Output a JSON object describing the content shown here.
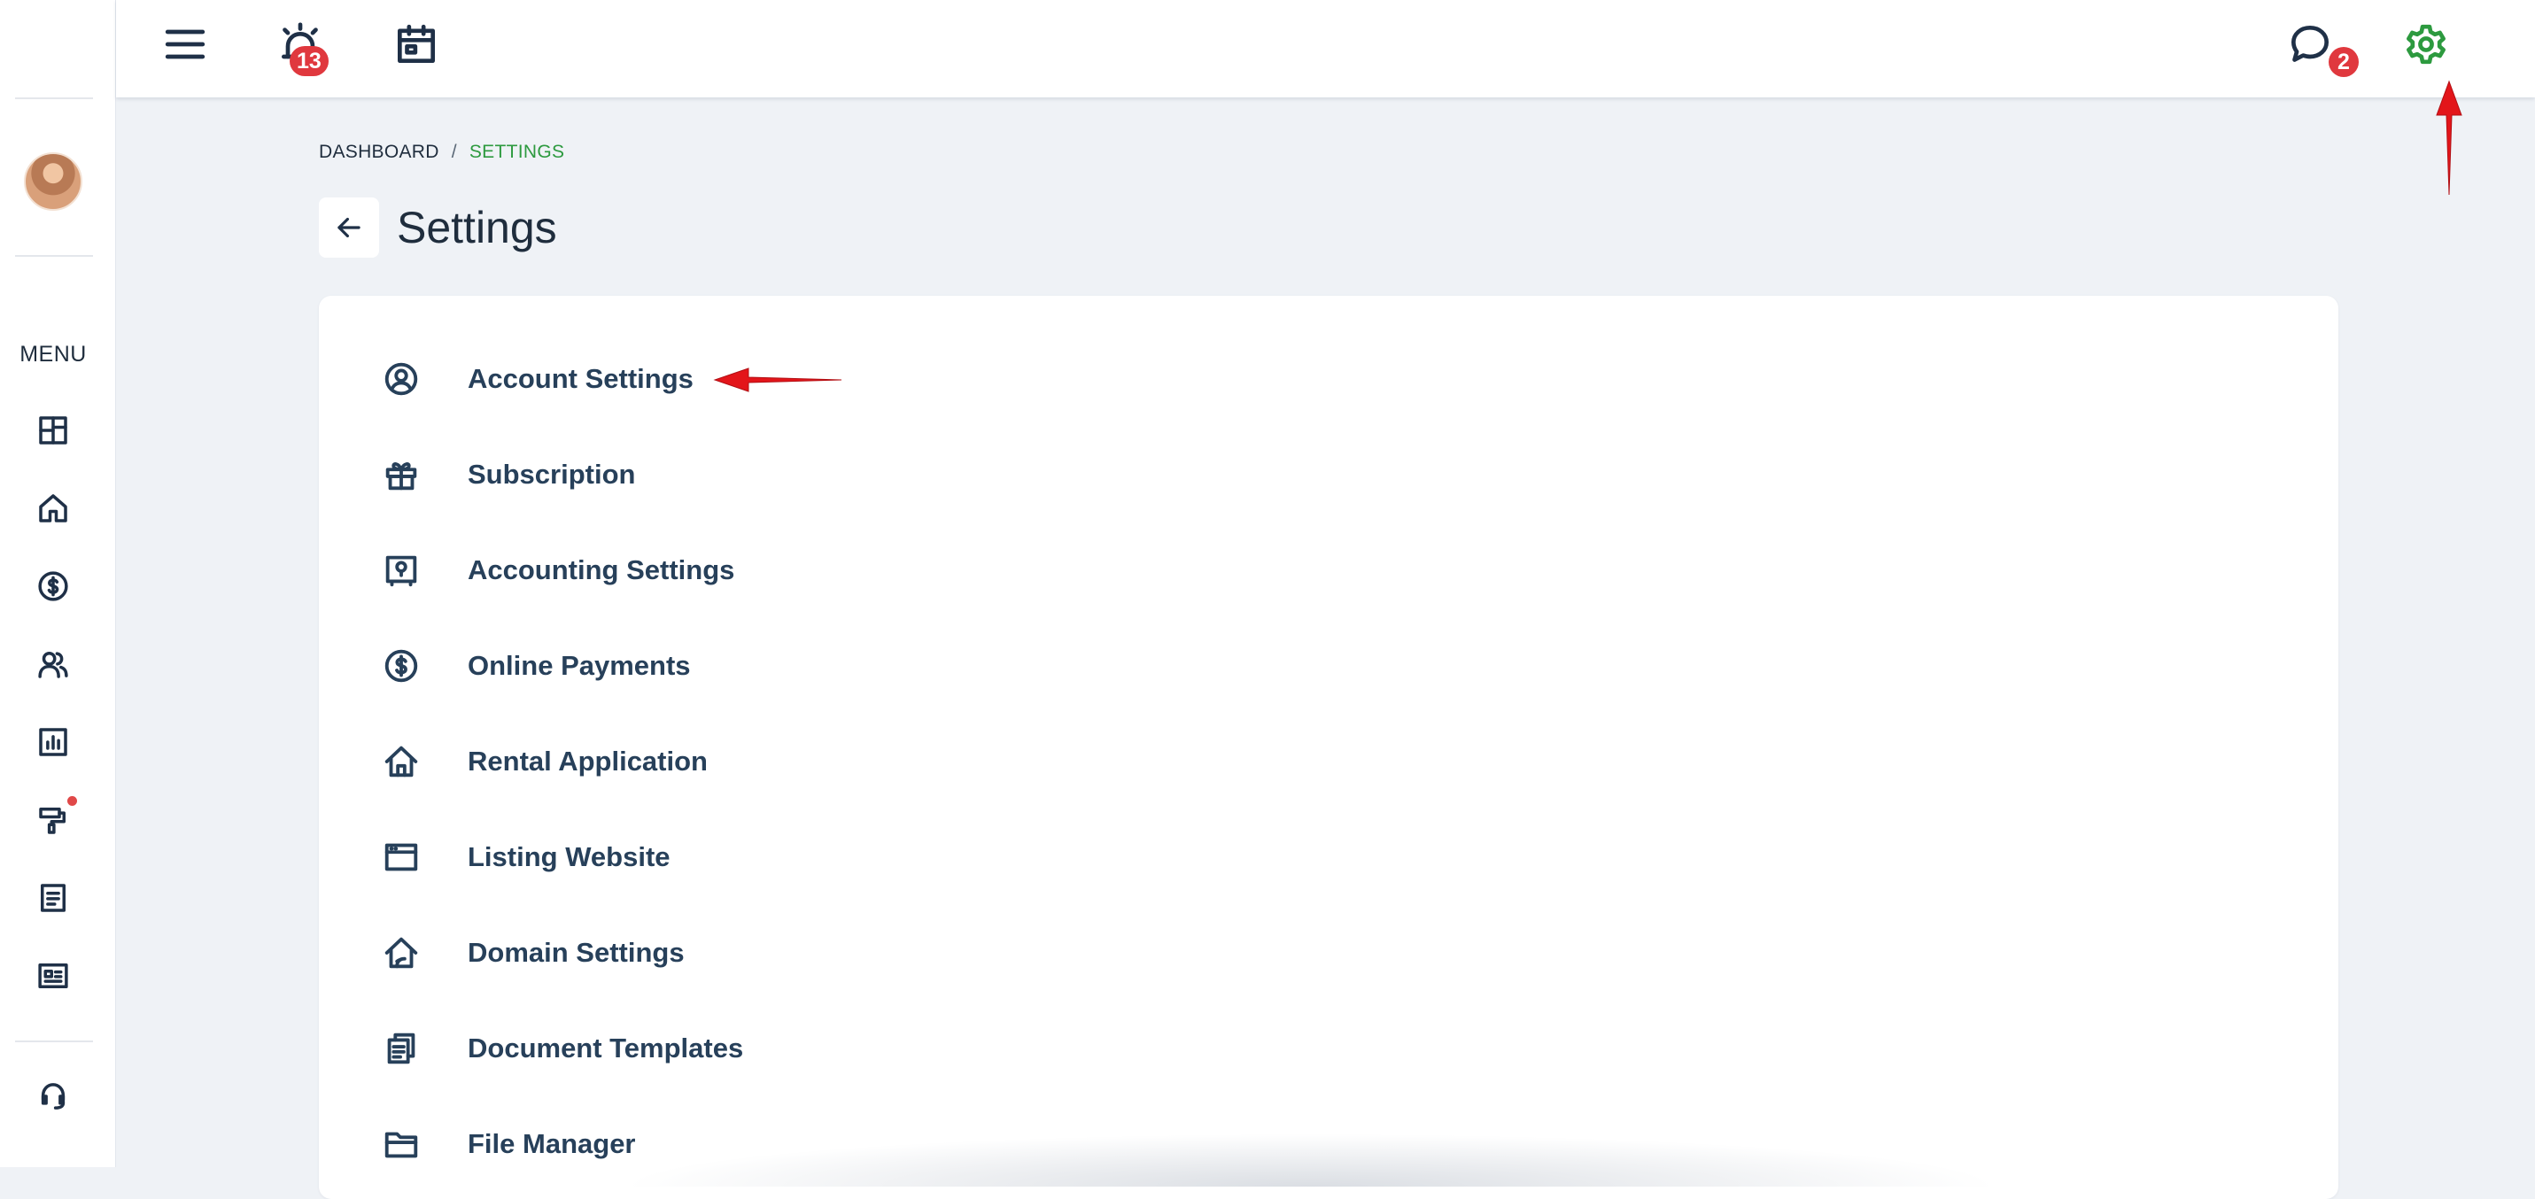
{
  "sidebar": {
    "menu_label": "MENU",
    "icons": [
      "layout-icon",
      "home-icon",
      "dollar-icon",
      "users-icon",
      "chart-icon",
      "paint-roller-icon",
      "document-icon",
      "listing-card-icon",
      "headset-icon"
    ]
  },
  "topbar": {
    "notifications_badge": "13",
    "messages_badge": "2",
    "settings_color": "#2d9a3f"
  },
  "breadcrumb": {
    "parent": "DASHBOARD",
    "separator": "/",
    "current": "SETTINGS"
  },
  "page": {
    "title": "Settings"
  },
  "settings_items": [
    {
      "label": "Account Settings",
      "icon": "user-circle-icon"
    },
    {
      "label": "Subscription",
      "icon": "gift-icon"
    },
    {
      "label": "Accounting Settings",
      "icon": "safe-icon"
    },
    {
      "label": "Online Payments",
      "icon": "dollar-circle-icon"
    },
    {
      "label": "Rental Application",
      "icon": "house-icon"
    },
    {
      "label": "Listing Website",
      "icon": "browser-window-icon"
    },
    {
      "label": "Domain Settings",
      "icon": "house-link-icon"
    },
    {
      "label": "Document Templates",
      "icon": "documents-icon"
    },
    {
      "label": "File Manager",
      "icon": "folder-icon"
    }
  ],
  "colors": {
    "accent_green": "#2d9a3f",
    "badge_red": "#e0383e",
    "annotation_red": "#e3151a",
    "text_dark": "#27405a"
  }
}
